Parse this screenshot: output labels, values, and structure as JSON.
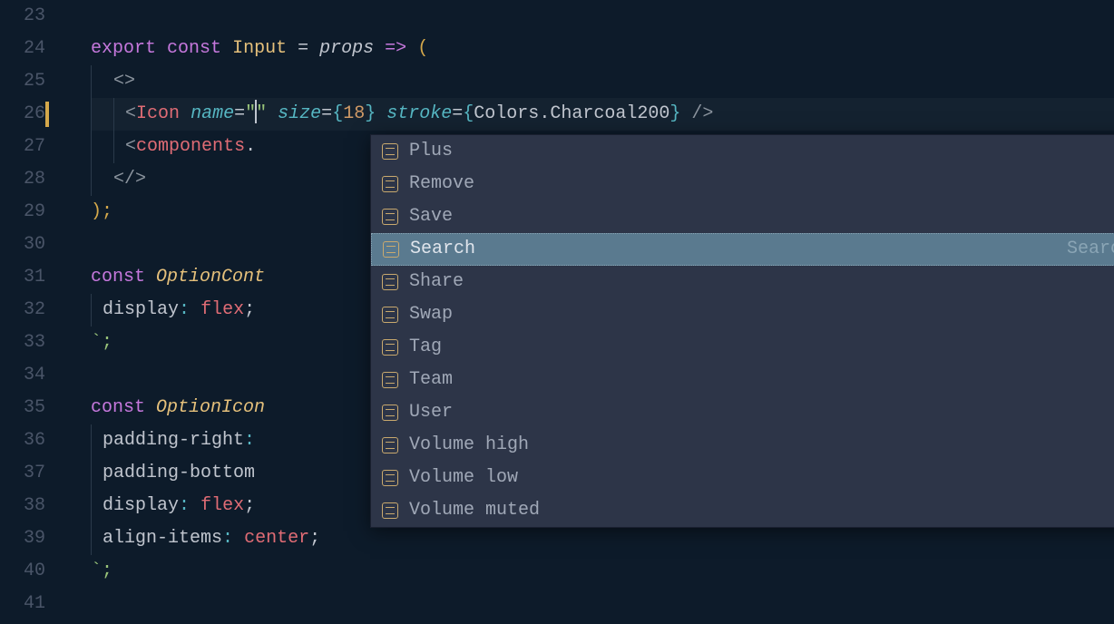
{
  "lines": {
    "start": 23,
    "end": 41,
    "modified": [
      26
    ]
  },
  "code": {
    "l24": {
      "export": "export",
      "const": "const",
      "name": "Input",
      "eq": "=",
      "props": "props",
      "arrow": "=>",
      "open": "("
    },
    "l25": {
      "frag": "<>"
    },
    "l26": {
      "lt": "<",
      "tag": "Icon",
      "attr_name": "name",
      "eq": "=",
      "q1": "\"",
      "q2": "\"",
      "attr_size": "size",
      "size_open": "{",
      "size_val": "18",
      "size_close": "}",
      "attr_stroke": "stroke",
      "stroke_open": "{",
      "stroke_obj": "Colors",
      "stroke_dot": ".",
      "stroke_mem": "Charcoal200",
      "stroke_close": "}",
      "slash": "/",
      "gt": ">"
    },
    "l27": {
      "lt": "<",
      "tag": "components",
      "dot": "."
    },
    "l28": {
      "frag_close": "</>"
    },
    "l29": {
      "close": ");"
    },
    "l31": {
      "const": "const",
      "name": "OptionCont"
    },
    "l32": {
      "prop": "display",
      "colon": ":",
      "val": "flex",
      "semi": ";"
    },
    "l33": {
      "close": "`;"
    },
    "l35": {
      "const": "const",
      "name": "OptionIcon"
    },
    "l36": {
      "prop": "padding-right",
      "colon": ":"
    },
    "l37": {
      "prop": "padding-bottom"
    },
    "l38": {
      "prop": "display",
      "colon": ":",
      "val": "flex",
      "semi": ";"
    },
    "l39": {
      "prop": "align-items",
      "colon": ":",
      "val": "center",
      "semi": ";"
    },
    "l40": {
      "close": "`;"
    }
  },
  "autocomplete": {
    "items": [
      {
        "label": "Plus"
      },
      {
        "label": "Remove"
      },
      {
        "label": "Save"
      },
      {
        "label": "Search",
        "detail": "Search",
        "selected": true
      },
      {
        "label": "Share"
      },
      {
        "label": "Swap"
      },
      {
        "label": "Tag"
      },
      {
        "label": "Team"
      },
      {
        "label": "User"
      },
      {
        "label": "Volume high"
      },
      {
        "label": "Volume low"
      },
      {
        "label": "Volume muted"
      }
    ]
  }
}
